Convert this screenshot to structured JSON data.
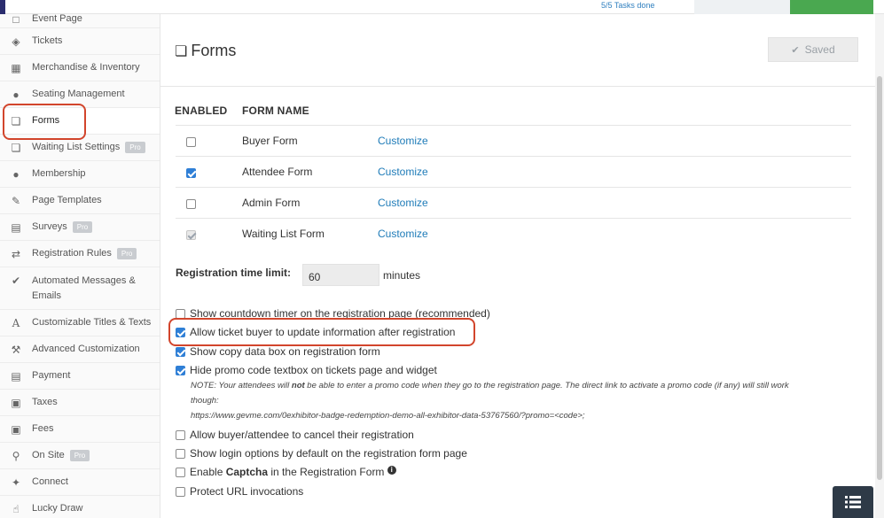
{
  "topbar": {
    "tasks_done": "5/5 Tasks done"
  },
  "sidebar": {
    "items": [
      {
        "label": "Event Page",
        "icon": "monitor-icon",
        "pro": ""
      },
      {
        "label": "Tickets",
        "icon": "ticket-icon",
        "pro": ""
      },
      {
        "label": "Merchandise & Inventory",
        "icon": "briefcase-icon",
        "pro": ""
      },
      {
        "label": "Seating Management",
        "icon": "users-icon",
        "pro": ""
      },
      {
        "label": "Forms",
        "icon": "copy-icon",
        "pro": ""
      },
      {
        "label": "Waiting List Settings",
        "icon": "copy-icon",
        "pro": "Pro"
      },
      {
        "label": "Membership",
        "icon": "group-icon",
        "pro": ""
      },
      {
        "label": "Page Templates",
        "icon": "edit-icon",
        "pro": ""
      },
      {
        "label": "Surveys",
        "icon": "document-icon",
        "pro": "Pro"
      },
      {
        "label": "Registration Rules",
        "icon": "shuffle-icon",
        "pro": "Pro"
      },
      {
        "label": "Automated Messages & Emails",
        "icon": "check-circle-icon",
        "pro": ""
      },
      {
        "label": "Customizable Titles & Texts",
        "icon": "font-icon",
        "pro": ""
      },
      {
        "label": "Advanced Customization",
        "icon": "wrench-icon",
        "pro": ""
      },
      {
        "label": "Payment",
        "icon": "credit-card-icon",
        "pro": ""
      },
      {
        "label": "Taxes",
        "icon": "money-icon",
        "pro": ""
      },
      {
        "label": "Fees",
        "icon": "money-icon",
        "pro": ""
      },
      {
        "label": "On Site",
        "icon": "map-marker-icon",
        "pro": "Pro"
      },
      {
        "label": "Connect",
        "icon": "plug-icon",
        "pro": ""
      },
      {
        "label": "Lucky Draw",
        "icon": "thumbs-up-icon",
        "pro": ""
      }
    ]
  },
  "header": {
    "title": "Forms",
    "saved_label": "Saved"
  },
  "forms_table": {
    "col_enabled": "ENABLED",
    "col_name": "FORM NAME",
    "rows": [
      {
        "name": "Buyer Form",
        "action": "Customize",
        "enabled": false
      },
      {
        "name": "Attendee Form",
        "action": "Customize",
        "enabled": true
      },
      {
        "name": "Admin Form",
        "action": "Customize",
        "enabled": false
      },
      {
        "name": "Waiting List Form",
        "action": "Customize",
        "enabled": true,
        "disabled": true
      }
    ]
  },
  "registration_time_limit": {
    "label": "Registration time limit:",
    "value": "60",
    "unit": "minutes"
  },
  "options": [
    {
      "label": "Show countdown timer on the registration page (recommended)",
      "checked": false
    },
    {
      "label": "Allow ticket buyer to update information after registration",
      "checked": true
    },
    {
      "label": "Show copy data box on registration form",
      "checked": true
    },
    {
      "label": "Hide promo code textbox on tickets page and widget",
      "checked": true
    },
    {
      "label": "Allow buyer/attendee to cancel their registration",
      "checked": false
    },
    {
      "label": "Show login options by default on the registration form page",
      "checked": false
    },
    {
      "label_prefix": "Enable ",
      "label_bold": "Captcha",
      "label_suffix": " in the Registration Form",
      "checked": false
    },
    {
      "label": "Protect URL invocations",
      "checked": false
    }
  ],
  "promo_note": {
    "prefix": "NOTE: Your attendees will ",
    "bold": "not",
    "suffix": " be able to enter a promo code when they go to the registration page. The direct link to activate a promo code (if any) will still work",
    "line2": "though:",
    "url": "https://www.gevme.com/0exhibitor-badge-redemption-demo-all-exhibitor-data-53767560/?promo=<code>;"
  },
  "colors": {
    "highlight": "#d2452c",
    "link": "#1e7bb8",
    "checkbox": "#2f7fd6"
  }
}
